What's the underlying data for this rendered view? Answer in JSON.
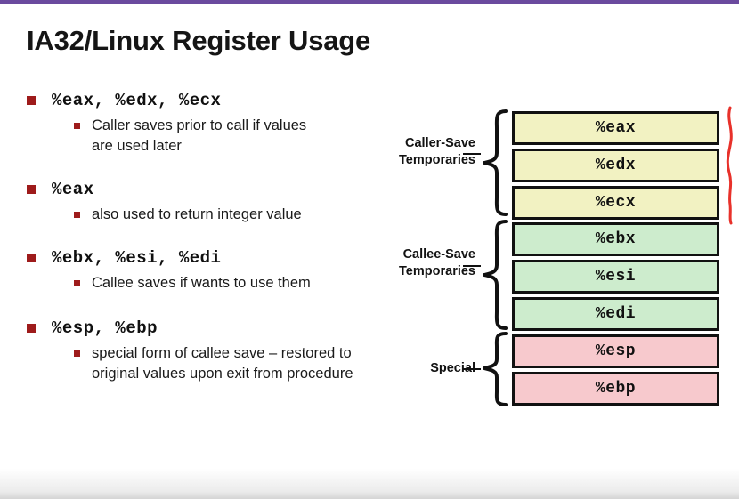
{
  "slide": {
    "title": "IA32/Linux Register Usage",
    "accent_bar_color": "#6b4a9e",
    "bullet_marker_color": "#9e1b1b",
    "ink_annotation_color": "#e8312a"
  },
  "bullets": [
    {
      "heading": "%eax, %edx, %ecx",
      "sub": "Caller saves prior to call if values are used later"
    },
    {
      "heading": "%eax",
      "sub": "also used to return integer value"
    },
    {
      "heading": "%ebx, %esi, %edi",
      "sub": "Callee saves if wants to use them"
    },
    {
      "heading": "%esp, %ebp",
      "sub": "special form of callee save – restored to original values upon exit from procedure"
    }
  ],
  "diagram": {
    "groups": [
      {
        "label_line1": "Caller-Save",
        "label_line2": "Temporaries",
        "color": "#f2f2c2",
        "registers": [
          "%eax",
          "%edx",
          "%ecx"
        ]
      },
      {
        "label_line1": "Callee-Save",
        "label_line2": "Temporaries",
        "color": "#cdeccd",
        "registers": [
          "%ebx",
          "%esi",
          "%edi"
        ]
      },
      {
        "label_line1": "Special",
        "label_line2": "",
        "color": "#f7c9cd",
        "registers": [
          "%esp",
          "%ebp"
        ]
      }
    ]
  }
}
